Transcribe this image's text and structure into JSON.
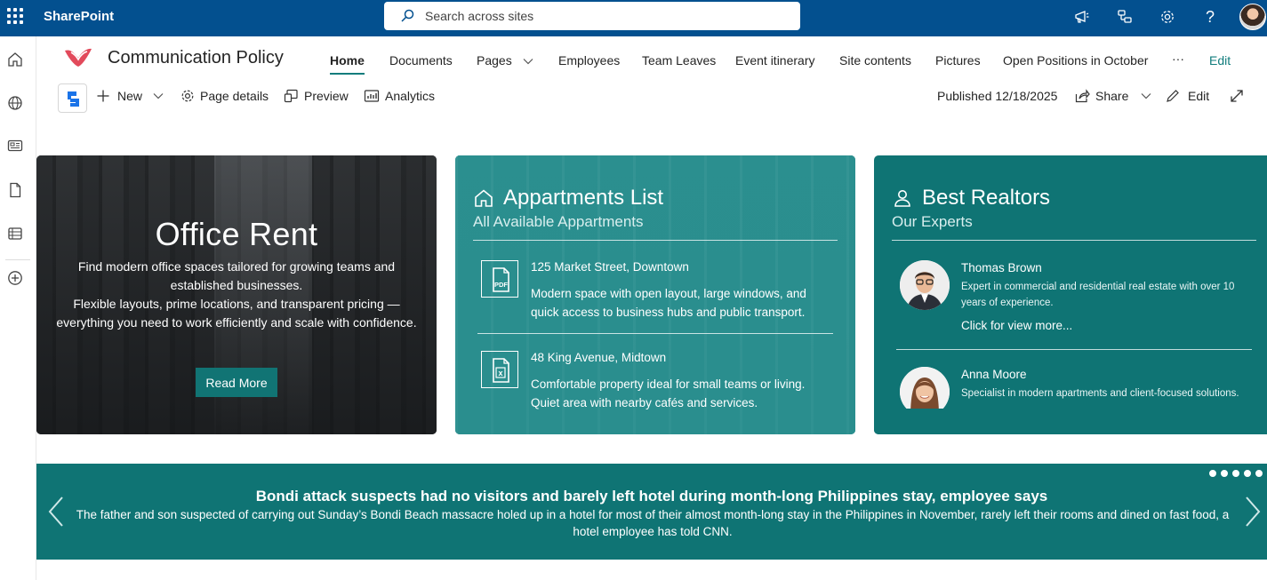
{
  "suite": {
    "app_name": "SharePoint",
    "search_placeholder": "Search across sites"
  },
  "site": {
    "title": "Communication Policy"
  },
  "nav": {
    "items": [
      {
        "label": "Home"
      },
      {
        "label": "Documents"
      },
      {
        "label": "Pages"
      },
      {
        "label": "Employees"
      },
      {
        "label": "Team Leaves"
      },
      {
        "label": "Event itinerary"
      },
      {
        "label": "Site contents"
      },
      {
        "label": "Pictures"
      },
      {
        "label": "Open Positions in October"
      }
    ],
    "more": "···",
    "edit": "Edit"
  },
  "commandbar": {
    "new": "New",
    "page_details": "Page details",
    "preview": "Preview",
    "analytics": "Analytics",
    "published": "Published 12/18/2025",
    "share": "Share",
    "edit": "Edit"
  },
  "office_card": {
    "title": "Office Rent",
    "desc_line1": "Find modern office spaces tailored for growing teams and established businesses.",
    "desc_line2": "Flexible layouts, prime locations, and transparent pricing — everything you need to work efficiently and scale with confidence.",
    "button": "Read More"
  },
  "apartments_card": {
    "title": "Appartments List",
    "subtitle": "All Available Appartments",
    "items": [
      {
        "address": "125 Market Street, Downtown",
        "description": "Modern space with open layout, large windows, and quick access to business hubs and public transport.",
        "icon": "pdf-file-icon",
        "icon_text": "PDF"
      },
      {
        "address": "48 King Avenue, Midtown",
        "description": "Comfortable property ideal for small teams or living. Quiet area with nearby cafés and services.",
        "icon": "excel-file-icon",
        "icon_text": "x"
      }
    ]
  },
  "realtors_card": {
    "title": "Best Realtors",
    "subtitle": "Our Experts",
    "experts": [
      {
        "name": "Thomas Brown",
        "bio": "Expert in commercial and residential real estate with over 10 years of experience.",
        "more": "Click for view more..."
      },
      {
        "name": "Anna Moore",
        "bio": "Specialist in modern apartments and client-focused solutions."
      }
    ]
  },
  "news": {
    "title": "Bondi attack suspects had no visitors and barely left hotel during month-long Philippines stay, employee says",
    "body": "The father and son suspected of carrying out Sunday’s Bondi Beach massacre holed up in a hotel for most of their almost month-long stay in the Philippines in November, rarely left their rooms and dined on fast food, a hotel employee has told CNN.",
    "slide_count": 5
  },
  "colors": {
    "suite_bar": "#03508f",
    "accent_teal": "#117c7c",
    "card_teal": "#0f7474"
  }
}
